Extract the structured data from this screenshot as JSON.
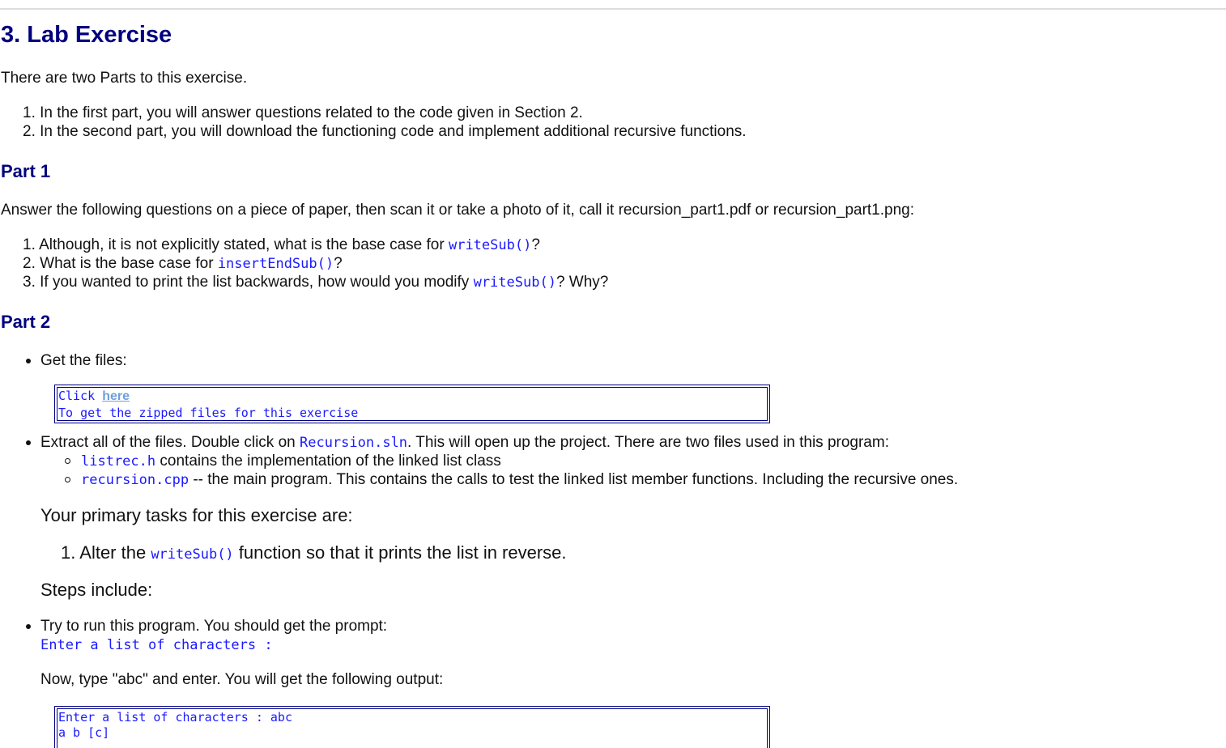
{
  "section": {
    "title": "3. Lab Exercise",
    "intro": "There are two Parts to this exercise.",
    "parts_overview": [
      {
        "num": "1.",
        "text": "In the first part, you will answer questions related to the code given in Section 2."
      },
      {
        "num": "2.",
        "text": "In the second part, you will download the functioning code and implement additional recursive functions."
      }
    ]
  },
  "part1": {
    "heading": "Part 1",
    "instructions": "Answer the following questions on a piece of paper, then scan it or take a photo of it, call it recursion_part1.pdf or recursion_part1.png:",
    "questions": [
      {
        "num": "1.",
        "before": "Although, it is not explicitly stated, what is the base case for ",
        "code": "writeSub()",
        "after": "?"
      },
      {
        "num": "2.",
        "before": "What is the base case for ",
        "code": "insertEndSub()",
        "after": "?"
      },
      {
        "num": "3.",
        "before": "If you wanted to print the list backwards, how would you modify ",
        "code": "writeSub()",
        "after": "? Why?"
      }
    ]
  },
  "part2": {
    "heading": "Part 2",
    "get_files_label": "Get the files:",
    "download_box": {
      "click_text": "Click ",
      "link_text": "here",
      "line2": "To get the zipped files for this exercise"
    },
    "extract": {
      "before": "Extract all of the files. Double click on ",
      "code": "Recursion.sln",
      "after": ". This will open up the project. There are two files used in this program:"
    },
    "files": [
      {
        "code": "listrec.h",
        "text": " contains the implementation of the linked list class"
      },
      {
        "code": "recursion.cpp",
        "text": " -- the main program. This contains the calls to test the linked list member functions. Including the recursive ones."
      }
    ],
    "tasks_heading": "Your primary tasks for this exercise are:",
    "tasks": [
      {
        "num": "1.",
        "before": "Alter the ",
        "code": "writeSub()",
        "after": " function so that it prints the list in reverse."
      }
    ],
    "steps_heading": "Steps include:",
    "run_step": "Try to run this program. You should get the prompt:",
    "prompt_code": "Enter a list of characters :",
    "now_type": "Now, type \"abc\" and enter. You will get the following output:",
    "output_box": {
      "line1": "Enter a list of characters : abc",
      "line2": "a b [c]"
    }
  },
  "colors": {
    "heading": "#000080",
    "code": "#1a1aff",
    "link": "#6f9fd8",
    "box_border": "#000080"
  }
}
